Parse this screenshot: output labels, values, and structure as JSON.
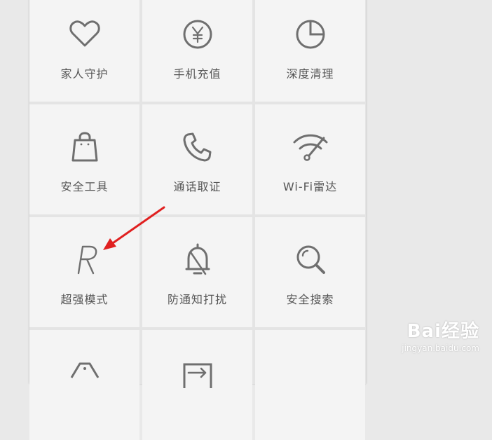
{
  "tiles": [
    {
      "label": "家人守护",
      "icon": "heart-icon"
    },
    {
      "label": "手机充值",
      "icon": "yen-coin-icon"
    },
    {
      "label": "深度清理",
      "icon": "pie-chart-icon"
    },
    {
      "label": "安全工具",
      "icon": "shopping-bag-icon"
    },
    {
      "label": "通话取证",
      "icon": "phone-icon"
    },
    {
      "label": "Wi-Fi雷达",
      "icon": "wifi-icon"
    },
    {
      "label": "超强模式",
      "icon": "r-letter-icon"
    },
    {
      "label": "防通知打扰",
      "icon": "bell-off-icon"
    },
    {
      "label": "安全搜索",
      "icon": "search-icon"
    },
    {
      "label": "",
      "icon": "tag-icon"
    },
    {
      "label": "",
      "icon": "export-icon"
    },
    {
      "label": "",
      "icon": ""
    }
  ],
  "annotation": {
    "arrow_color": "#e02020"
  },
  "watermark": {
    "brand": "Bai经验",
    "url": "jingyan.baidu.com"
  },
  "colors": {
    "icon": "#6f6f6f",
    "label": "#555555",
    "tile": "#f4f4f4",
    "gap": "#e4e4e4"
  }
}
